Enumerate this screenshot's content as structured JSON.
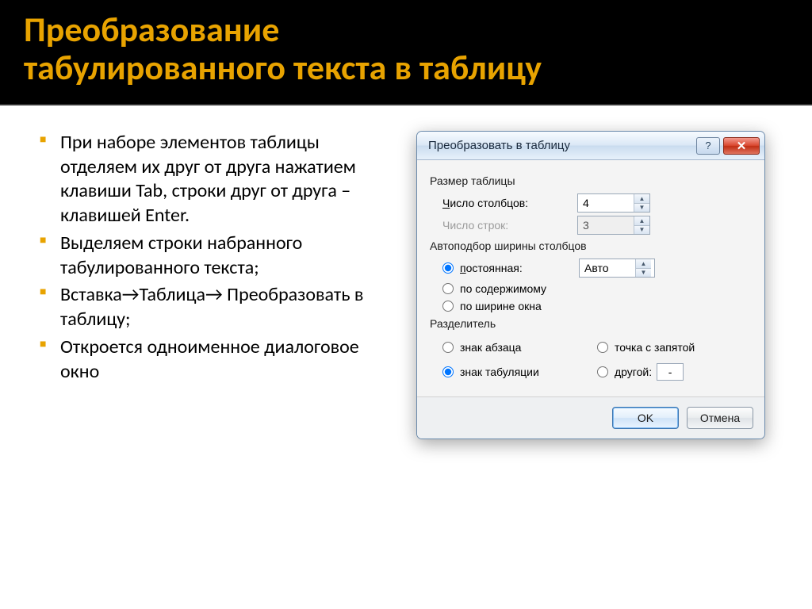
{
  "slide": {
    "title_line1": "Преобразование",
    "title_line2": "табулированного текста в таблицу",
    "bullets": [
      "При наборе элементов таблицы отделяем их друг от друга нажатием клавиши Tab, строки друг от друга – клавишей Enter.",
      "Выделяем строки набранного табулированного текста;",
      "Вставка→Таблица→ Преобразовать в таблицу;",
      "Откроется одноименное диалоговое окно"
    ]
  },
  "dialog": {
    "title": "Преобразовать в таблицу",
    "group_size": "Размер таблицы",
    "cols_label": "Число столбцов:",
    "cols_value": "4",
    "rows_label": "Число строк:",
    "rows_value": "3",
    "group_autofit": "Автоподбор ширины столбцов",
    "autofit_fixed": "постоянная:",
    "autofit_fixed_value": "Авто",
    "autofit_content": "по содержимому",
    "autofit_window": "по ширине окна",
    "group_sep": "Разделитель",
    "sep_para": "знак абзаца",
    "sep_semi": "точка с запятой",
    "sep_tab": "знак табуляции",
    "sep_other": "другой:",
    "sep_other_value": "-",
    "ok": "OK",
    "cancel": "Отмена"
  }
}
